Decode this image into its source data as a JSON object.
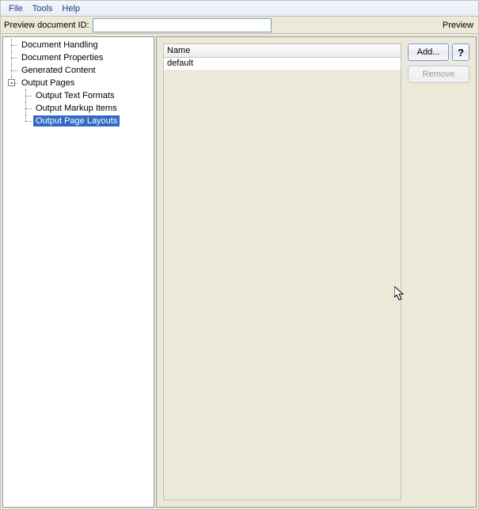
{
  "menubar": {
    "file": "File",
    "tools": "Tools",
    "help": "Help"
  },
  "toolbar": {
    "preview_label": "Preview document ID:",
    "preview_value": "",
    "preview_button": "Preview"
  },
  "tree": {
    "doc_handling": "Document Handling",
    "doc_properties": "Document Properties",
    "generated_content": "Generated Content",
    "output_pages": "Output Pages",
    "output_text_formats": "Output Text Formats",
    "output_markup_items": "Output Markup Items",
    "output_page_layouts": "Output Page Layouts"
  },
  "expander_minus": "-",
  "content": {
    "column_header": "Name",
    "row0": "default",
    "add_button": "Add...",
    "help_button": "?",
    "remove_button": "Remove"
  }
}
